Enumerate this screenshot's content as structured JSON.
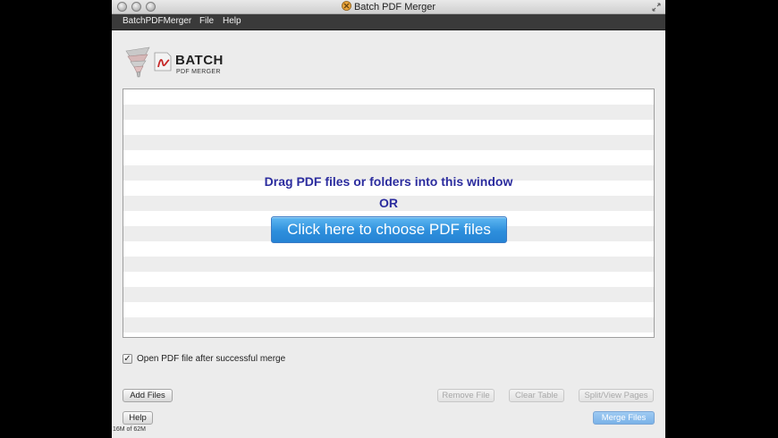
{
  "window": {
    "title": "Batch PDF Merger"
  },
  "menubar": {
    "items": [
      {
        "label": "BatchPDFMerger"
      },
      {
        "label": "File"
      },
      {
        "label": "Help"
      }
    ]
  },
  "logo": {
    "title": "BATCH",
    "subtitle": "PDF MERGER"
  },
  "droparea": {
    "instruction": "Drag PDF files or folders into this window",
    "or_text": "OR",
    "choose_button": "Click here to choose PDF files"
  },
  "options": {
    "open_after_merge_label": "Open PDF file after successful merge",
    "open_after_merge_checked": true,
    "check_glyph": "✓"
  },
  "buttons": {
    "add_files": "Add Files",
    "remove_file": "Remove File",
    "clear_table": "Clear Table",
    "split_view": "Split/View Pages",
    "help": "Help",
    "merge_files": "Merge Files"
  },
  "status": {
    "memory": "16M of 62M"
  },
  "colors": {
    "accent_text": "#2b2c9e",
    "choose_button_blue": "#2e8fdc",
    "logo_red": "#c62828"
  },
  "icons": {
    "app": "pdf-merger-app-icon",
    "resize": "fullscreen-icon",
    "checkbox": "checkmark-icon"
  }
}
